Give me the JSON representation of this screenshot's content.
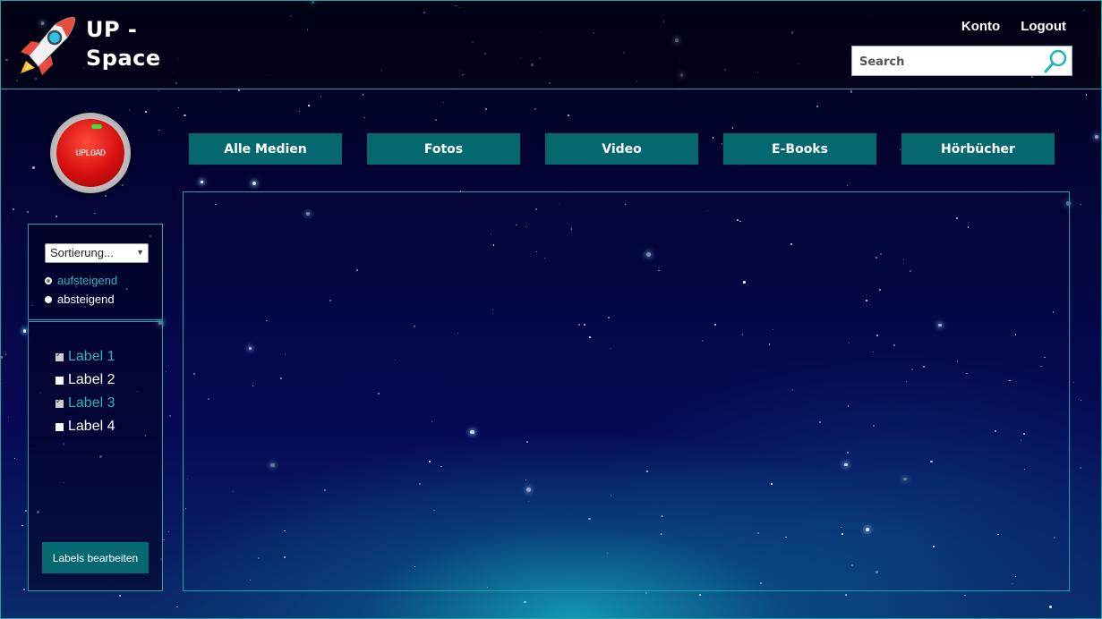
{
  "header": {
    "brand_line1": "UP  -",
    "brand_line2": "Space",
    "links": {
      "account": "Konto",
      "logout": "Logout"
    },
    "search": {
      "placeholder": "Search",
      "value": ""
    }
  },
  "upload": {
    "label": "UPLOAD"
  },
  "tabs": [
    {
      "label": "Alle Medien"
    },
    {
      "label": "Fotos"
    },
    {
      "label": "Video"
    },
    {
      "label": "E-Books"
    },
    {
      "label": "Hörbücher"
    }
  ],
  "sort": {
    "select_value": "Sortierung...",
    "options": [
      {
        "label": "aufsteigend",
        "selected": true
      },
      {
        "label": "absteigend",
        "selected": false
      }
    ]
  },
  "labels": {
    "items": [
      {
        "label": "Label 1",
        "checked": true
      },
      {
        "label": "Label 2",
        "checked": false
      },
      {
        "label": "Label 3",
        "checked": true
      },
      {
        "label": "Label 4",
        "checked": false
      }
    ],
    "edit_button": "Labels bearbeiten"
  },
  "colors": {
    "accent": "#1fa3a8",
    "tab_bg": "#056870",
    "selected_text": "#2bb4c0"
  }
}
